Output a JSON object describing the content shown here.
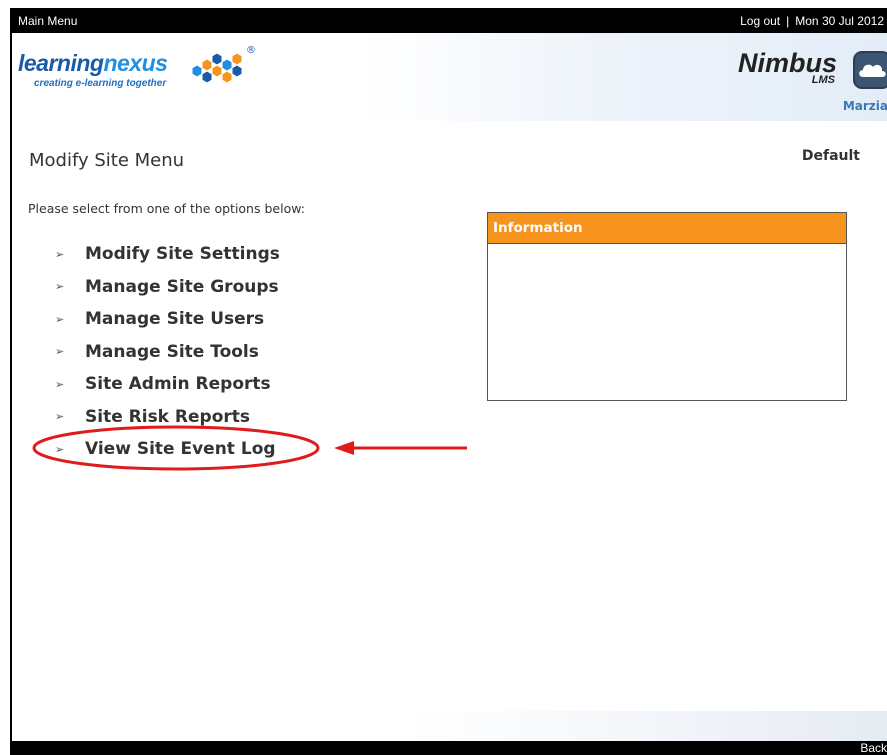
{
  "topbar": {
    "main_menu": "Main Menu",
    "logout": "Log out",
    "separator": "|",
    "date": "Mon 30 Jul 2012"
  },
  "header": {
    "logo": {
      "word_part1": "learning",
      "word_part2": "nexus",
      "tagline": "creating e-learning together",
      "registered": "®"
    },
    "product": {
      "name": "Nimbus",
      "sub": "LMS"
    },
    "username": "Marzia"
  },
  "page": {
    "title": "Modify Site Menu",
    "context_label": "Default",
    "instructions": "Please select from one of the options below:"
  },
  "menu": {
    "bullet": "➢",
    "items": [
      {
        "label": "Modify Site Settings"
      },
      {
        "label": "Manage Site Groups"
      },
      {
        "label": "Manage Site Users"
      },
      {
        "label": "Manage Site Tools"
      },
      {
        "label": "Site Admin Reports"
      },
      {
        "label": "Site Risk Reports"
      },
      {
        "label": "View Site Event Log"
      }
    ]
  },
  "info_panel": {
    "title": "Information",
    "header_color": "#f7941e"
  },
  "annotation": {
    "color": "#e01b1b",
    "highlighted_item": "View Site Event Log"
  },
  "footer": {
    "back": "Back"
  },
  "colors": {
    "accent_orange": "#f7941e",
    "brand_blue": "#1a5aa8",
    "username_blue": "#3a78b8",
    "annotation_red": "#e01b1b"
  }
}
